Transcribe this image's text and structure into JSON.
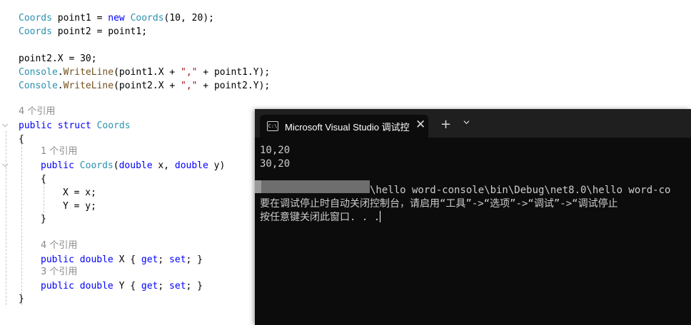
{
  "code": {
    "line1": {
      "type": "Coords",
      "var": "point1",
      "eq": " = ",
      "kw_new": "new",
      "ctor": "Coords",
      "args": "(10, 20);"
    },
    "line2": {
      "type": "Coords",
      "rest": " point2 = point1;"
    },
    "line3": {
      "text": "point2.X = 30;"
    },
    "line4": {
      "console": "Console",
      "dot": ".",
      "method": "WriteLine",
      "open": "(point1.X + ",
      "str": "\",\"",
      "close": " + point1.Y);"
    },
    "line5": {
      "console": "Console",
      "dot": ".",
      "method": "WriteLine",
      "open": "(point2.X + ",
      "str": "\",\"",
      "close": " + point2.Y);"
    },
    "refs_struct": "4 个引用",
    "struct_decl": {
      "kw1": "public",
      "kw2": "struct",
      "name": "Coords"
    },
    "brace_open": "{",
    "refs_ctor": "1 个引用",
    "ctor_decl": {
      "kw": "public",
      "name": "Coords",
      "p_open": "(",
      "t1": "double",
      "a1": " x, ",
      "t2": "double",
      "a2": " y)"
    },
    "ctor_brace_open": "{",
    "assign_x": "X = x;",
    "assign_y": "Y = y;",
    "ctor_brace_close": "}",
    "refs_x": "4 个引用",
    "prop_x": {
      "kw1": "public",
      "kw2": "double",
      "name": " X { ",
      "get": "get",
      "semi1": "; ",
      "set": "set",
      "end": "; }"
    },
    "refs_y": "3 个引用",
    "prop_y": {
      "kw1": "public",
      "kw2": "double",
      "name": " Y { ",
      "get": "get",
      "semi1": "; ",
      "set": "set",
      "end": "; }"
    },
    "brace_close": "}"
  },
  "console": {
    "tab_title": "Microsoft Visual Studio 调试控",
    "tab_close": "✕",
    "new_tab": "+",
    "output": {
      "line1": "10,20",
      "line2": "30,20",
      "path": "\\hello word-console\\bin\\Debug\\net8.0\\hello word-co",
      "msg1": "要在调试停止时自动关闭控制台，请启用“工具”->“选项”->“调试”->“调试停止",
      "msg2": "按任意键关闭此窗口. . ."
    }
  },
  "colors": {
    "keyword": "#0000ff",
    "type": "#2b91af",
    "string": "#a31515",
    "method": "#74531f",
    "console_bg": "#0c0c0c"
  },
  "icons": [
    "chevron-down-icon",
    "console-app-icon",
    "close-icon",
    "plus-icon"
  ]
}
